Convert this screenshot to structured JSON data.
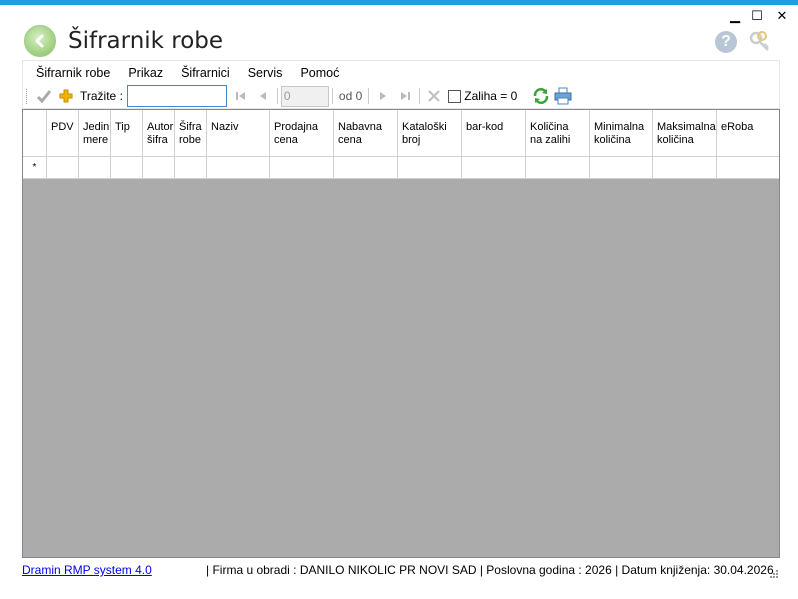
{
  "window": {
    "title": "Šifrarnik robe",
    "minimize_glyph": "▁",
    "maximize_glyph": "☐",
    "close_glyph": "✕"
  },
  "header": {
    "help_glyph": "?"
  },
  "menu": [
    {
      "label": "Šifrarnik robe"
    },
    {
      "label": "Prikaz"
    },
    {
      "label": "Šifrarnici"
    },
    {
      "label": "Servis"
    },
    {
      "label": "Pomoć"
    }
  ],
  "toolbar": {
    "search_label": "Tražite :",
    "search_value": "",
    "position_value": "0",
    "of_label": "od 0",
    "zaliha_label": "Zaliha = 0",
    "zaliha_checked": false
  },
  "grid": {
    "columns": [
      {
        "label": "PDV"
      },
      {
        "label": "Jedin\nmere"
      },
      {
        "label": "Tip"
      },
      {
        "label": "Autor\nšifra"
      },
      {
        "label": "Šifra\nrobe"
      },
      {
        "label": "Naziv"
      },
      {
        "label": "Prodajna\ncena"
      },
      {
        "label": "Nabavna\ncena"
      },
      {
        "label": "Kataloški\nbroj"
      },
      {
        "label": "bar-kod"
      },
      {
        "label": "Količina\nna zalihi"
      },
      {
        "label": "Minimalna\nkoličina"
      },
      {
        "label": "Maksimalna\nkoličina"
      },
      {
        "label": "eRoba"
      }
    ],
    "new_row_marker": "*"
  },
  "status": {
    "link": "Dramin RMP system 4.0",
    "info": "|  Firma u obradi : DANILO NIKOLIC PR NOVI SAD  |  Poslovna godina : 2026  |  Datum knjiženja: 30.04.2026"
  },
  "colors": {
    "accent": "#1ba1e2",
    "grid_background": "#ababab",
    "link": "#0000ee",
    "refresh_icon": "#3aa33a",
    "add_icon": "#f0b400"
  },
  "icons": [
    "back-arrow-icon",
    "help-icon",
    "keys-icon",
    "check-icon",
    "add-icon",
    "first-record-icon",
    "previous-record-icon",
    "next-record-icon",
    "last-record-icon",
    "delete-icon",
    "refresh-icon",
    "printer-icon"
  ]
}
